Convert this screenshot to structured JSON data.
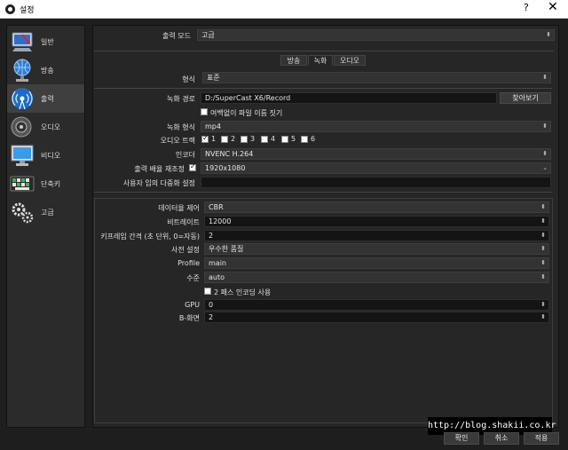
{
  "window": {
    "title": "설정",
    "help": "?",
    "close": "✕"
  },
  "sidebar": {
    "items": [
      {
        "label": "일반",
        "icon": "monitor-icon"
      },
      {
        "label": "방송",
        "icon": "globe-icon"
      },
      {
        "label": "출력",
        "icon": "broadcast-icon"
      },
      {
        "label": "오디오",
        "icon": "speaker-icon"
      },
      {
        "label": "비디오",
        "icon": "display-icon"
      },
      {
        "label": "단축키",
        "icon": "keyboard-icon"
      },
      {
        "label": "고급",
        "icon": "gears-icon"
      }
    ],
    "active": "출력"
  },
  "output_mode": {
    "label": "출력 모드",
    "value": "고급"
  },
  "tabs": [
    "방송",
    "녹화",
    "오디오"
  ],
  "active_tab": "녹화",
  "recording": {
    "type_label": "형식",
    "type_value": "표준",
    "path_label": "녹화 경로",
    "path_value": "D:/SuperCast X6/Record",
    "browse_label": "찾아보기",
    "no_space_label": "여백없이 파일 이름 짓기",
    "format_label": "녹화 형식",
    "format_value": "mp4",
    "tracks_label": "오디오 트랙",
    "tracks": [
      "1",
      "2",
      "3",
      "4",
      "5",
      "6"
    ],
    "encoder_label": "인코더",
    "encoder_value": "NVENC H.264",
    "rescale_label": "출력 배율 재조정",
    "rescale_value": "1920x1080",
    "muxer_label": "사용자 임의 다중화 설정",
    "muxer_value": ""
  },
  "encoder_settings": {
    "rate_control_label": "데이터율 제어",
    "rate_control_value": "CBR",
    "bitrate_label": "비트레이트",
    "bitrate_value": "12000",
    "keyframe_label": "키프레임 간격 (초 단위, 0=자동)",
    "keyframe_value": "2",
    "preset_label": "사전 설정",
    "preset_value": "우수한 품질",
    "profile_label": "Profile",
    "profile_value": "main",
    "level_label": "수준",
    "level_value": "auto",
    "twopass_label": "2 패스 인코딩 사용",
    "gpu_label": "GPU",
    "gpu_value": "0",
    "bframes_label": "B-화면",
    "bframes_value": "2"
  },
  "buttons": {
    "ok": "확인",
    "cancel": "취소",
    "apply": "적용"
  },
  "watermark": "http://blog.shakii.co.kr"
}
